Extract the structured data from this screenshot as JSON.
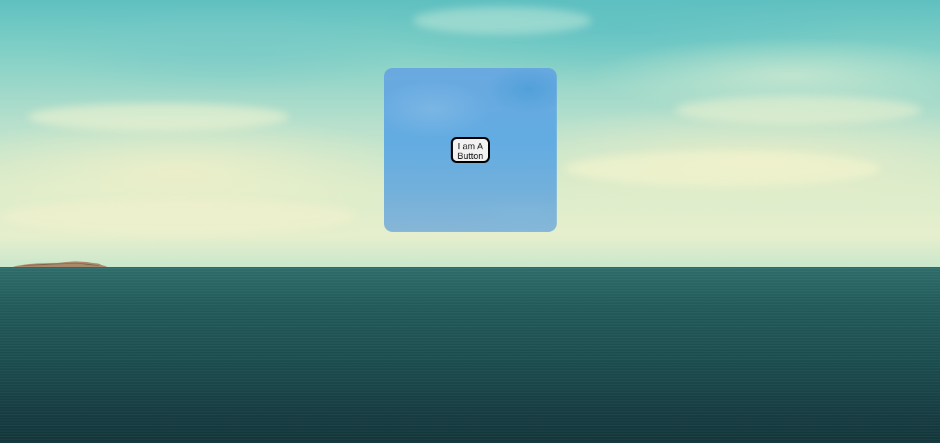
{
  "panel": {
    "button_label": "I am A Button"
  },
  "colors": {
    "sky_top": "#5fc0c0",
    "sky_horizon": "#e6efcd",
    "sea": "#1c4f51",
    "panel": "#62ace2",
    "button_bg": "#f2f2f2",
    "button_border": "#000000"
  }
}
